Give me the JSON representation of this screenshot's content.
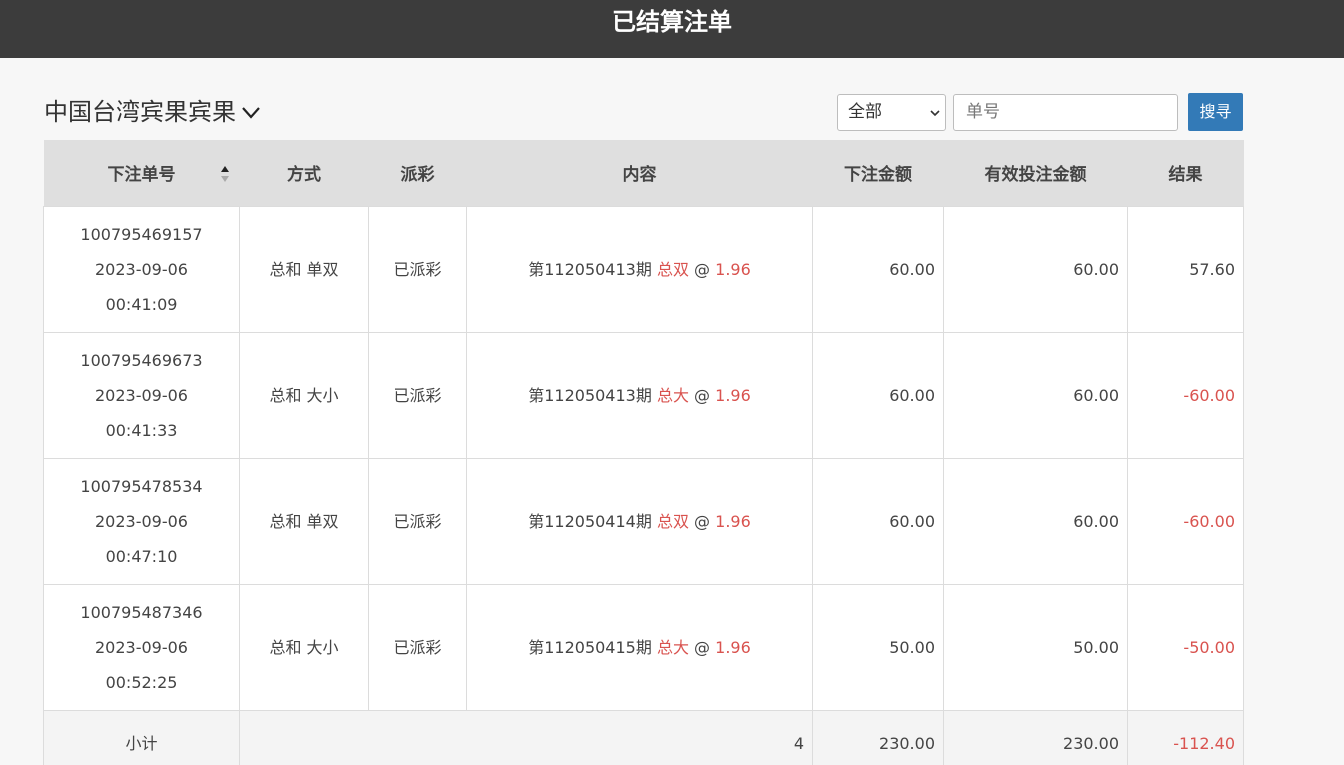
{
  "header": {
    "title": "已结算注单"
  },
  "game": {
    "name": "中国台湾宾果宾果"
  },
  "filter": {
    "selected": "全部",
    "search_placeholder": "单号",
    "search_button": "搜寻"
  },
  "table": {
    "columns": [
      "下注单号",
      "方式",
      "派彩",
      "内容",
      "下注金额",
      "有效投注金额",
      "结果"
    ],
    "rows": [
      {
        "order": "100795469157",
        "date": "2023-09-06",
        "time": "00:41:09",
        "method": "总和 单双",
        "status": "已派彩",
        "period": "第112050413期",
        "pick": "总双",
        "at": "@",
        "odds": "1.96",
        "amount": "60.00",
        "valid": "60.00",
        "result": "57.60",
        "result_color": "#444444"
      },
      {
        "order": "100795469673",
        "date": "2023-09-06",
        "time": "00:41:33",
        "method": "总和 大小",
        "status": "已派彩",
        "period": "第112050413期",
        "pick": "总大",
        "at": "@",
        "odds": "1.96",
        "amount": "60.00",
        "valid": "60.00",
        "result": "-60.00",
        "result_color": "#d9534f"
      },
      {
        "order": "100795478534",
        "date": "2023-09-06",
        "time": "00:47:10",
        "method": "总和 单双",
        "status": "已派彩",
        "period": "第112050414期",
        "pick": "总双",
        "at": "@",
        "odds": "1.96",
        "amount": "60.00",
        "valid": "60.00",
        "result": "-60.00",
        "result_color": "#d9534f"
      },
      {
        "order": "100795487346",
        "date": "2023-09-06",
        "time": "00:52:25",
        "method": "总和 大小",
        "status": "已派彩",
        "period": "第112050415期",
        "pick": "总大",
        "at": "@",
        "odds": "1.96",
        "amount": "50.00",
        "valid": "50.00",
        "result": "-50.00",
        "result_color": "#d9534f"
      }
    ],
    "subtotal": {
      "label": "小计",
      "count": "4",
      "amount": "230.00",
      "valid": "230.00",
      "result": "-112.40"
    }
  },
  "colors": {
    "header_bg": "#3c3c3c",
    "accent_button": "#337ab7",
    "negative": "#d9534f"
  }
}
